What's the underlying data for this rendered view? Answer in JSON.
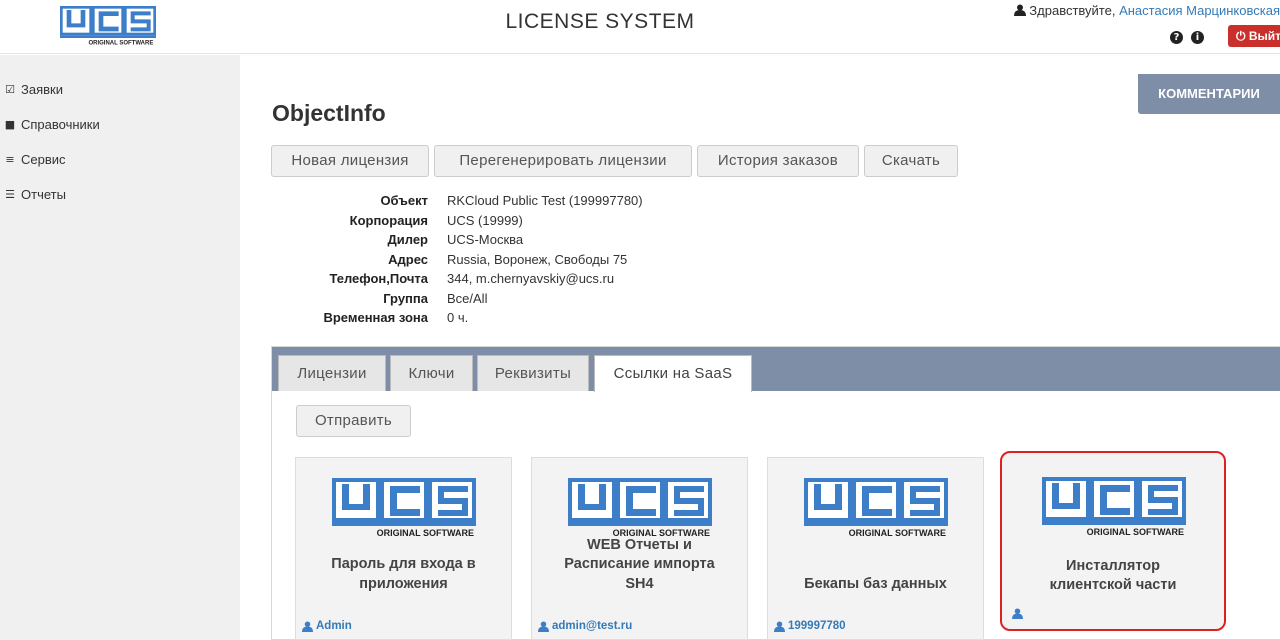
{
  "header": {
    "app_title": "LICENSE SYSTEM",
    "greeting": "Здравствуйте,",
    "user_name": "Анастасия Марцинковская",
    "logout_label": "Выйти",
    "logo_text": "UCS",
    "logo_sub": "ORIGINAL SOFTWARE"
  },
  "sidebar": {
    "items": [
      {
        "label": "Заявки",
        "icon": "check-square-icon"
      },
      {
        "label": "Справочники",
        "icon": "book-icon"
      },
      {
        "label": "Сервис",
        "icon": "list-icon"
      },
      {
        "label": "Отчеты",
        "icon": "list-ul-icon"
      }
    ]
  },
  "page": {
    "title": "ObjectInfo",
    "comments_label": "КОММЕНТАРИИ",
    "actions": {
      "new_license": "Новая лицензия",
      "regenerate": "Перегенерировать лицензии",
      "order_history": "История заказов",
      "download": "Скачать"
    }
  },
  "info": {
    "rows": [
      {
        "label": "Объект",
        "value": "RKCloud Public Test (199997780)"
      },
      {
        "label": "Корпорация",
        "value": "UCS (19999)"
      },
      {
        "label": "Дилер",
        "value": "UCS-Москва"
      },
      {
        "label": "Адрес",
        "value": "Russia, Воронеж, Свободы 75"
      },
      {
        "label": "Телефон,Почта",
        "value": "344, m.chernyavskiy@ucs.ru"
      },
      {
        "label": "Группа",
        "value": "Все/All"
      },
      {
        "label": "Временная зона",
        "value": "0 ч."
      }
    ]
  },
  "tabs": {
    "items": [
      "Лицензии",
      "Ключи",
      "Реквизиты",
      "Ссылки на SaaS"
    ],
    "active": "Ссылки на SaaS",
    "send_label": "Отправить"
  },
  "cards": [
    {
      "title_line1": "Пароль для входа в",
      "title_line2": "приложения",
      "title_line3": "",
      "user": "Admin"
    },
    {
      "title_line1": "WEB Отчеты и",
      "title_line2": "Расписание импорта",
      "title_line3": "SH4",
      "user": "admin@test.ru"
    },
    {
      "title_line1": "Бекапы баз данных",
      "title_line2": "",
      "title_line3": "",
      "user": "199997780"
    },
    {
      "title_line1": "Инсталлятор",
      "title_line2": "клиентской части",
      "title_line3": "",
      "user": ""
    }
  ],
  "colors": {
    "brand_blue": "#3d7ec9",
    "tab_bar": "#7d8ea6",
    "logout_red": "#c9302c",
    "highlight_red": "#e02020",
    "link_blue": "#337ab7"
  }
}
